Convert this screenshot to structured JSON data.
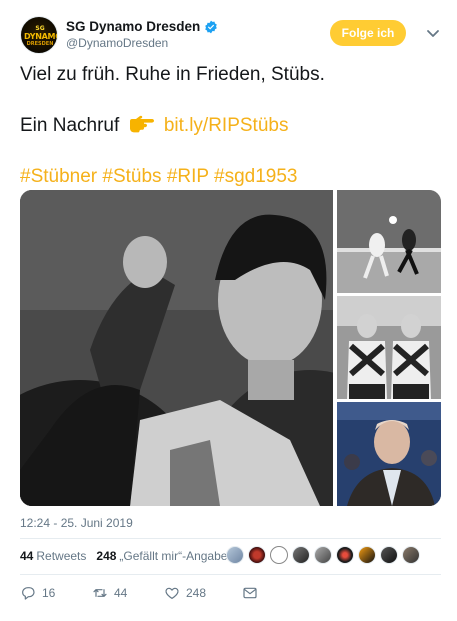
{
  "author": {
    "display_name": "SG Dynamo Dresden",
    "handle": "@DynamoDresden",
    "avatar_lines": [
      "SG",
      "DYNAMO",
      "DRESDEN"
    ],
    "verified": true
  },
  "follow_label": "Folge ich",
  "tweet": {
    "line1": "Viel zu früh. Ruhe in Frieden, Stübs.",
    "line2_text": "Ein Nachruf",
    "emoji": "pointing-right-icon",
    "link": "bit.ly/RIPStübs",
    "hashtags": [
      "#Stübner",
      "#Stübs",
      "#RIP",
      "#sgd1953"
    ]
  },
  "media": {
    "count": 4,
    "descriptions": [
      "black-and-white portrait",
      "match scene",
      "two players in striped kit",
      "man in blue stadium"
    ]
  },
  "timestamp": "12:24 - 25. Juni 2019",
  "stats": {
    "retweets_count": "44",
    "retweets_label": "Retweets",
    "likes_count": "248",
    "likes_label": "„Gefällt mir“-Angaben",
    "liker_count": 9
  },
  "actions": {
    "reply_count": "16",
    "retweet_count": "44",
    "like_count": "248"
  },
  "colors": {
    "accent": "#ffcc33",
    "link": "#f5b11a",
    "muted": "#657786",
    "verified": "#1da1f2"
  }
}
